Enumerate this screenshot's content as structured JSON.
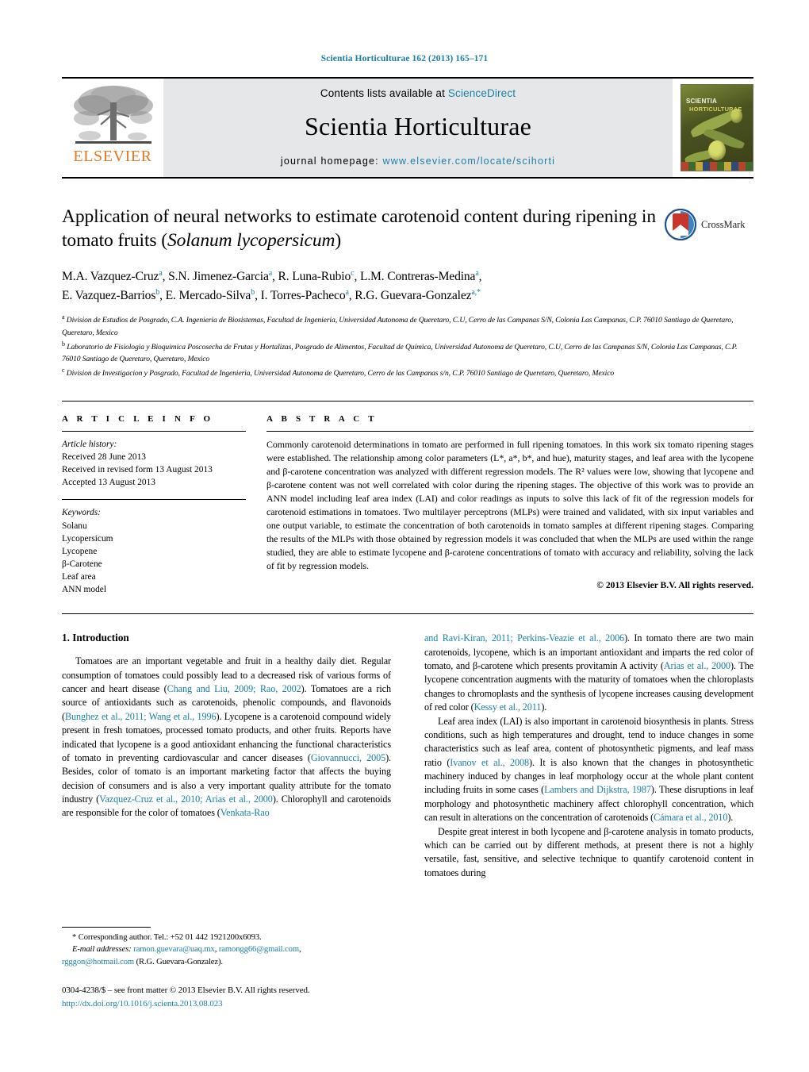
{
  "running_head": "Scientia Horticulturae 162 (2013) 165–171",
  "masthead": {
    "publisher_name": "ELSEVIER",
    "contents_prefix": "Contents lists available at ",
    "contents_link": "ScienceDirect",
    "journal_title": "Scientia Horticulturae",
    "homepage_prefix": "journal homepage: ",
    "homepage_url": "www.elsevier.com/locate/scihorti",
    "cover_line1": "SCIENTIA",
    "cover_line2": "HORTICULTURAE"
  },
  "article": {
    "title_part1": "Application of neural networks to estimate carotenoid content during ripening in tomato fruits (",
    "title_italic": "Solanum lycopersicum",
    "title_part2": ")",
    "crossmark_label": "CrossMark"
  },
  "authors": {
    "line1": "M.A. Vazquez-Cruz",
    "line1_sup1": "a",
    "a2": "S.N. Jimenez-Garcia",
    "a2_sup": "a",
    "a3": "R. Luna-Rubio",
    "a3_sup": "c",
    "a4": "L.M. Contreras-Medina",
    "a4_sup": "a",
    "a5": "E. Vazquez-Barrios",
    "a5_sup": "b",
    "a6": "E. Mercado-Silva",
    "a6_sup": "b",
    "a7": "I. Torres-Pacheco",
    "a7_sup": "a",
    "a8": "R.G. Guevara-Gonzalez",
    "a8_sup": "a,*"
  },
  "affiliations": [
    {
      "marker": "a",
      "text": "Division de Estudios de Posgrado, C.A. Ingenieria de Biosistemas, Facultad de Ingenieria, Universidad Autonoma de Queretaro, C.U, Cerro de las Campanas S/N, Colonia Las Campanas, C.P. 76010 Santiago de Queretaro, Queretaro, Mexico"
    },
    {
      "marker": "b",
      "text": "Laboratorio de Fisiologia y Bioquimica Poscosecha de Frutas y Hortalizas, Posgrado de Alimentos, Facultad de Química, Universidad Autonoma de Queretaro, C.U, Cerro de las Campanas S/N, Colonia Las Campanas, C.P. 76010 Santiago de Queretaro, Queretaro, Mexico"
    },
    {
      "marker": "c",
      "text": "Division de Investigacion y Posgrado, Facultad de Ingenieria, Universidad Autonoma de Queretaro, Cerro de las Campanas s/n, C.P. 76010 Santiago de Queretaro, Queretaro, Mexico"
    }
  ],
  "article_info": {
    "heading": "A R T I C L E   I N F O",
    "history_label": "Article history:",
    "history": [
      "Received 28 June 2013",
      "Received in revised form 13 August 2013",
      "Accepted 13 August 2013"
    ],
    "keywords_label": "Keywords:",
    "keywords": [
      "Solanu",
      "Lycopersicum",
      "Lycopene",
      "β-Carotene",
      "Leaf area",
      "ANN model"
    ]
  },
  "abstract": {
    "heading": "A B S T R A C T",
    "text": "Commonly carotenoid determinations in tomato are performed in full ripening tomatoes. In this work six tomato ripening stages were established. The relationship among color parameters (L*, a*, b*, and hue), maturity stages, and leaf area with the lycopene and β-carotene concentration was analyzed with different regression models. The R² values were low, showing that lycopene and β-carotene content was not well correlated with color during the ripening stages. The objective of this work was to provide an ANN model including leaf area index (LAI) and color readings as inputs to solve this lack of fit of the regression models for carotenoid estimations in tomatoes. Two multilayer perceptrons (MLPs) were trained and validated, with six input variables and one output variable, to estimate the concentration of both carotenoids in tomato samples at different ripening stages. Comparing the results of the MLPs with those obtained by regression models it was concluded that when the MLPs are used within the range studied, they are able to estimate lycopene and β-carotene concentrations of tomato with accuracy and reliability, solving the lack of fit by regression models.",
    "copyright": "© 2013 Elsevier B.V. All rights reserved."
  },
  "introduction": {
    "section_number_title": "1.  Introduction",
    "left_para1_a": "Tomatoes are an important vegetable and fruit in a healthy daily diet. Regular consumption of tomatoes could possibly lead to a decreased risk of various forms of cancer and heart disease (",
    "left_ref1": "Chang and Liu, 2009; Rao, 2002",
    "left_para1_b": "). Tomatoes are a rich source of antioxidants such as carotenoids, phenolic compounds, and flavonoids (",
    "left_ref2": "Bunghez et al., 2011; Wang et al., 1996",
    "left_para1_c": "). Lycopene is a carotenoid compound widely present in fresh tomatoes, processed tomato products, and other fruits. Reports have indicated that lycopene is a good antioxidant enhancing the functional characteristics of tomato in preventing cardiovascular and cancer diseases (",
    "left_ref3": "Giovannucci, 2005",
    "left_para1_d": "). Besides, color of tomato is an important marketing factor that affects the buying decision of consumers and is also a very important quality attribute for the tomato industry (",
    "left_ref4": "Vazquez-Cruz et al., 2010; Arias et al., 2000",
    "left_para1_e": "). Chlorophyll and carotenoids are responsible for the color of tomatoes (",
    "left_ref5": "Venkata-Rao",
    "right_ref_cont": "and Ravi-Kiran, 2011; Perkins-Veazie et al., 2006",
    "right_para1_a": "). In tomato there are two main carotenoids, lycopene, which is an important antioxidant and imparts the red color of tomato, and β-carotene which presents provitamin A activity (",
    "right_ref1": "Arias et al., 2000",
    "right_para1_b": "). The lycopene concentration augments with the maturity of tomatoes when the chloroplasts changes to chromoplasts and the synthesis of lycopene increases causing development of red color (",
    "right_ref2": "Kessy et al., 2011",
    "right_para1_c": ").",
    "right_para2_a": "Leaf area index (LAI) is also important in carotenoid biosynthesis in plants. Stress conditions, such as high temperatures and drought, tend to induce changes in some characteristics such as leaf area, content of photosynthetic pigments, and leaf mass ratio (",
    "right_ref3": "Ivanov et al., 2008",
    "right_para2_b": "). It is also known that the changes in photosynthetic machinery induced by changes in leaf morphology occur at the whole plant content including fruits in some cases (",
    "right_ref4": "Lambers and Dijkstra, 1987",
    "right_para2_c": "). These disruptions in leaf morphology and photosynthetic machinery affect chlorophyll concentration, which can result in alterations on the concentration of carotenoids (",
    "right_ref5": "Cámara et al., 2010",
    "right_para2_d": ").",
    "right_para3": "Despite great interest in both lycopene and β-carotene analysis in tomato products, which can be carried out by different methods, at present there is not a highly versatile, fast, sensitive, and selective technique to quantify carotenoid content in tomatoes during"
  },
  "footnote": {
    "corresponding": "*  Corresponding author. Tel.: +52 01 442 1921200x6093.",
    "email_label": "E-mail addresses:",
    "email1": "ramon.guevara@uaq.mx",
    "email2": "ramongg66@gmail.com",
    "email3": "rgggon@hotmail.com",
    "email_owner": "(R.G. Guevara-Gonzalez)."
  },
  "footer": {
    "issn_line": "0304-4238/$ – see front matter © 2013 Elsevier B.V. All rights reserved.",
    "doi": "http://dx.doi.org/10.1016/j.scienta.2013.08.023"
  },
  "colors": {
    "link_blue": "#1a7fa8",
    "elsevier_orange": "#E87722",
    "band_grey": "#e6e7e8",
    "crossmark_red": "#c8352a"
  }
}
